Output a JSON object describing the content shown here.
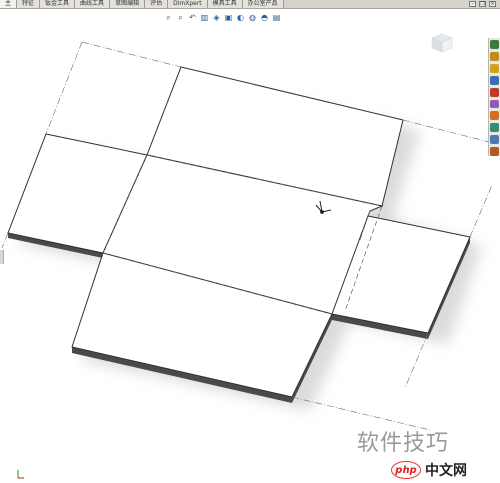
{
  "tabs": [
    {
      "label": "主"
    },
    {
      "label": "特征"
    },
    {
      "label": "钣金工具"
    },
    {
      "label": "曲线工具"
    },
    {
      "label": "草图编辑"
    },
    {
      "label": "评估"
    },
    {
      "label": "DimXpert"
    },
    {
      "label": "模具工具"
    },
    {
      "label": "办公室产品"
    }
  ],
  "viewbar_icons": [
    {
      "name": "zoom-to-fit-icon",
      "glyph": "⌕"
    },
    {
      "name": "zoom-area-icon",
      "glyph": "⌕"
    },
    {
      "name": "previous-view-icon",
      "glyph": "↶"
    },
    {
      "name": "section-view-icon",
      "glyph": "▥"
    },
    {
      "name": "view-orientation-icon",
      "glyph": "◈"
    },
    {
      "name": "display-style-icon",
      "glyph": "▣"
    },
    {
      "name": "hide-show-icon",
      "glyph": "◐"
    },
    {
      "name": "edit-appearance-icon",
      "glyph": "◍"
    },
    {
      "name": "apply-scene-icon",
      "glyph": "◓"
    },
    {
      "name": "view-settings-icon",
      "glyph": "▤"
    }
  ],
  "taskpane_icons": [
    {
      "name": "resources-icon",
      "color": "#3a7a3a"
    },
    {
      "name": "design-library-icon",
      "color": "#c48a1a"
    },
    {
      "name": "file-explorer-icon",
      "color": "#d4a020"
    },
    {
      "name": "view-palette-icon",
      "color": "#3b6fb5"
    },
    {
      "name": "appearances-icon",
      "color": "#c0392b"
    },
    {
      "name": "custom-properties-icon",
      "color": "#8e5cb5"
    },
    {
      "name": "solidworks-forum-icon",
      "color": "#d07020"
    },
    {
      "name": "recognition-icon",
      "color": "#2f8f6f"
    },
    {
      "name": "search-icon",
      "color": "#4a7ab0"
    },
    {
      "name": "toolbox-icon",
      "color": "#b35a1e"
    }
  ],
  "window_controls": [
    {
      "name": "minimize-icon",
      "glyph": "–"
    },
    {
      "name": "restore-icon",
      "glyph": "❐"
    },
    {
      "name": "close-icon",
      "glyph": "×"
    }
  ],
  "watermark_text": "软件技巧",
  "badge_site": "中文网",
  "badge_logo_text": "php",
  "colors": {
    "face": "#ffffff",
    "edge": "#303030",
    "thickness": "#4a4a4a",
    "shadow": "#cfcfcf",
    "dash": "#5a5a5a",
    "tabbar": "#d6d3ce"
  }
}
